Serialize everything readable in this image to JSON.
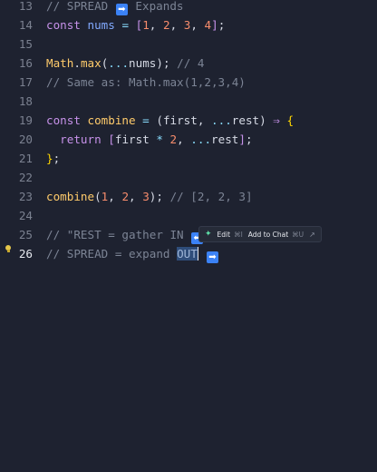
{
  "editor": {
    "active_line": "26",
    "lines": [
      {
        "num": "13",
        "tokens": [
          {
            "text": "// SPREAD ",
            "cls": "t-comment"
          },
          {
            "emoji": "➡"
          },
          {
            "text": " Expands",
            "cls": "t-comment"
          }
        ]
      },
      {
        "num": "14",
        "tokens": [
          {
            "text": "const",
            "cls": "t-kw"
          },
          {
            "text": " ",
            "cls": "t-plain"
          },
          {
            "text": "nums",
            "cls": "t-var"
          },
          {
            "text": " = ",
            "cls": "t-op"
          },
          {
            "text": "[",
            "cls": "t-bracket"
          },
          {
            "text": "1",
            "cls": "t-num"
          },
          {
            "text": ", ",
            "cls": "t-plain"
          },
          {
            "text": "2",
            "cls": "t-num"
          },
          {
            "text": ", ",
            "cls": "t-plain"
          },
          {
            "text": "3",
            "cls": "t-num"
          },
          {
            "text": ", ",
            "cls": "t-plain"
          },
          {
            "text": "4",
            "cls": "t-num"
          },
          {
            "text": "]",
            "cls": "t-bracket"
          },
          {
            "text": ";",
            "cls": "t-plain"
          }
        ]
      },
      {
        "num": "15",
        "tokens": []
      },
      {
        "num": "16",
        "tokens": [
          {
            "text": "Math",
            "cls": "t-fn"
          },
          {
            "text": ".",
            "cls": "t-plain"
          },
          {
            "text": "max",
            "cls": "t-fn"
          },
          {
            "text": "(",
            "cls": "t-paren"
          },
          {
            "text": "...",
            "cls": "t-op"
          },
          {
            "text": "nums",
            "cls": "t-plain"
          },
          {
            "text": ")",
            "cls": "t-paren"
          },
          {
            "text": "; ",
            "cls": "t-plain"
          },
          {
            "text": "// 4",
            "cls": "t-comment"
          }
        ]
      },
      {
        "num": "17",
        "tokens": [
          {
            "text": "// Same as: Math.max(1,2,3,4)",
            "cls": "t-comment"
          }
        ]
      },
      {
        "num": "18",
        "tokens": []
      },
      {
        "num": "19",
        "tokens": [
          {
            "text": "const",
            "cls": "t-kw"
          },
          {
            "text": " ",
            "cls": "t-plain"
          },
          {
            "text": "combine",
            "cls": "t-fn"
          },
          {
            "text": " = ",
            "cls": "t-op"
          },
          {
            "text": "(",
            "cls": "t-paren"
          },
          {
            "text": "first",
            "cls": "t-plain"
          },
          {
            "text": ", ",
            "cls": "t-plain"
          },
          {
            "text": "...",
            "cls": "t-op"
          },
          {
            "text": "rest",
            "cls": "t-plain"
          },
          {
            "text": ")",
            "cls": "t-paren"
          },
          {
            "text": " ⇒ ",
            "cls": "t-kw"
          },
          {
            "text": "{",
            "cls": "t-brace"
          }
        ]
      },
      {
        "num": "20",
        "tokens": [
          {
            "text": "  ",
            "cls": "t-plain"
          },
          {
            "text": "return",
            "cls": "t-kw"
          },
          {
            "text": " ",
            "cls": "t-plain"
          },
          {
            "text": "[",
            "cls": "t-bracket"
          },
          {
            "text": "first",
            "cls": "t-plain"
          },
          {
            "text": " * ",
            "cls": "t-op"
          },
          {
            "text": "2",
            "cls": "t-num"
          },
          {
            "text": ", ",
            "cls": "t-plain"
          },
          {
            "text": "...",
            "cls": "t-op"
          },
          {
            "text": "rest",
            "cls": "t-plain"
          },
          {
            "text": "]",
            "cls": "t-bracket"
          },
          {
            "text": ";",
            "cls": "t-plain"
          }
        ]
      },
      {
        "num": "21",
        "tokens": [
          {
            "text": "}",
            "cls": "t-brace"
          },
          {
            "text": ";",
            "cls": "t-plain"
          }
        ]
      },
      {
        "num": "22",
        "tokens": []
      },
      {
        "num": "23",
        "tokens": [
          {
            "text": "combine",
            "cls": "t-fn"
          },
          {
            "text": "(",
            "cls": "t-paren"
          },
          {
            "text": "1",
            "cls": "t-num"
          },
          {
            "text": ", ",
            "cls": "t-plain"
          },
          {
            "text": "2",
            "cls": "t-num"
          },
          {
            "text": ", ",
            "cls": "t-plain"
          },
          {
            "text": "3",
            "cls": "t-num"
          },
          {
            "text": ")",
            "cls": "t-paren"
          },
          {
            "text": "; ",
            "cls": "t-plain"
          },
          {
            "text": "// [2, 2, 3]",
            "cls": "t-comment"
          }
        ]
      },
      {
        "num": "24",
        "tokens": []
      },
      {
        "num": "25",
        "tokens": [
          {
            "text": "// \"REST = gather IN ",
            "cls": "t-comment"
          },
          {
            "emoji": "⬅"
          }
        ]
      },
      {
        "num": "26",
        "tokens": [
          {
            "text": "// SPREAD = expand ",
            "cls": "t-comment"
          },
          {
            "text": "OUT",
            "cls": "t-comment",
            "selected": true
          },
          {
            "cursor": true
          },
          {
            "text": " ",
            "cls": "t-plain"
          },
          {
            "emoji": "➡"
          }
        ]
      }
    ]
  },
  "inline_toolbar": {
    "spark_icon": "sparkle-icon",
    "edit_label": "Edit",
    "edit_shortcut": "⌘I",
    "chat_label": "Add to Chat",
    "chat_shortcut": "⌘U",
    "close_glyph": "↗"
  },
  "colors": {
    "background": "#1e2230",
    "keyword": "#c792ea",
    "function": "#ffcb6b",
    "number": "#f78c6c",
    "comment": "#7c8495",
    "emoji_tile": "#3b82f6"
  }
}
